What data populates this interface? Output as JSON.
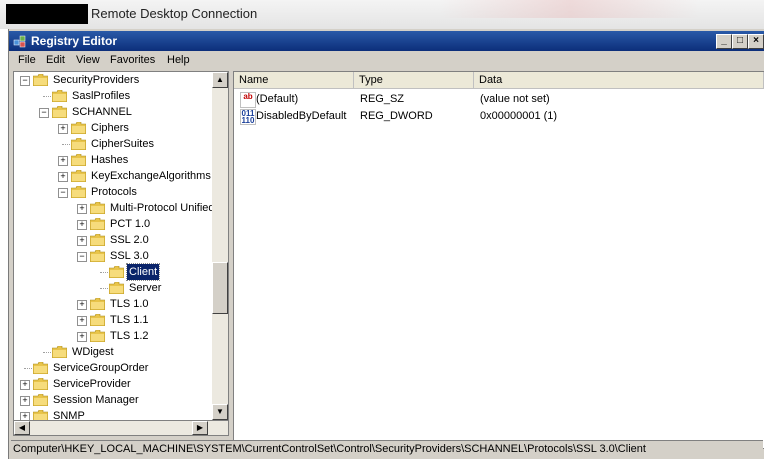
{
  "rdp": {
    "title": "Remote Desktop Connection"
  },
  "window": {
    "title": "Registry Editor",
    "controls": {
      "minimize": "_",
      "maximize": "□",
      "close": "×"
    }
  },
  "menu": [
    "File",
    "Edit",
    "View",
    "Favorites",
    "Help"
  ],
  "tree": [
    {
      "label": "SecurityProviders",
      "expander": "−"
    },
    {
      "label": "SaslProfiles",
      "expander": ""
    },
    {
      "label": "SCHANNEL",
      "expander": "−"
    },
    {
      "label": "Ciphers",
      "expander": "+"
    },
    {
      "label": "CipherSuites",
      "expander": ""
    },
    {
      "label": "Hashes",
      "expander": "+"
    },
    {
      "label": "KeyExchangeAlgorithms",
      "expander": "+"
    },
    {
      "label": "Protocols",
      "expander": "−"
    },
    {
      "label": "Multi-Protocol Unified",
      "expander": "+"
    },
    {
      "label": "PCT 1.0",
      "expander": "+"
    },
    {
      "label": "SSL 2.0",
      "expander": "+"
    },
    {
      "label": "SSL 3.0",
      "expander": "−"
    },
    {
      "label": "Client",
      "expander": "",
      "selected": true
    },
    {
      "label": "Server",
      "expander": ""
    },
    {
      "label": "TLS 1.0",
      "expander": "+"
    },
    {
      "label": "TLS 1.1",
      "expander": "+"
    },
    {
      "label": "TLS 1.2",
      "expander": "+"
    },
    {
      "label": "WDigest",
      "expander": ""
    },
    {
      "label": "ServiceGroupOrder",
      "expander": ""
    },
    {
      "label": "ServiceProvider",
      "expander": "+"
    },
    {
      "label": "Session Manager",
      "expander": "+"
    },
    {
      "label": "SNMP",
      "expander": "+"
    }
  ],
  "list": {
    "columns": [
      "Name",
      "Type",
      "Data"
    ],
    "rows": [
      {
        "icon": "string-value-icon",
        "name": "(Default)",
        "type": "REG_SZ",
        "data": "(value not set)"
      },
      {
        "icon": "binary-value-icon",
        "name": "DisabledByDefault",
        "type": "REG_DWORD",
        "data": "0x00000001 (1)"
      }
    ]
  },
  "status": "Computer\\HKEY_LOCAL_MACHINE\\SYSTEM\\CurrentControlSet\\Control\\SecurityProviders\\SCHANNEL\\Protocols\\SSL 3.0\\Client",
  "colors": {
    "titlebar": "#0c2e7a",
    "folder": "#e8c44a",
    "selection": "#0a246a"
  }
}
